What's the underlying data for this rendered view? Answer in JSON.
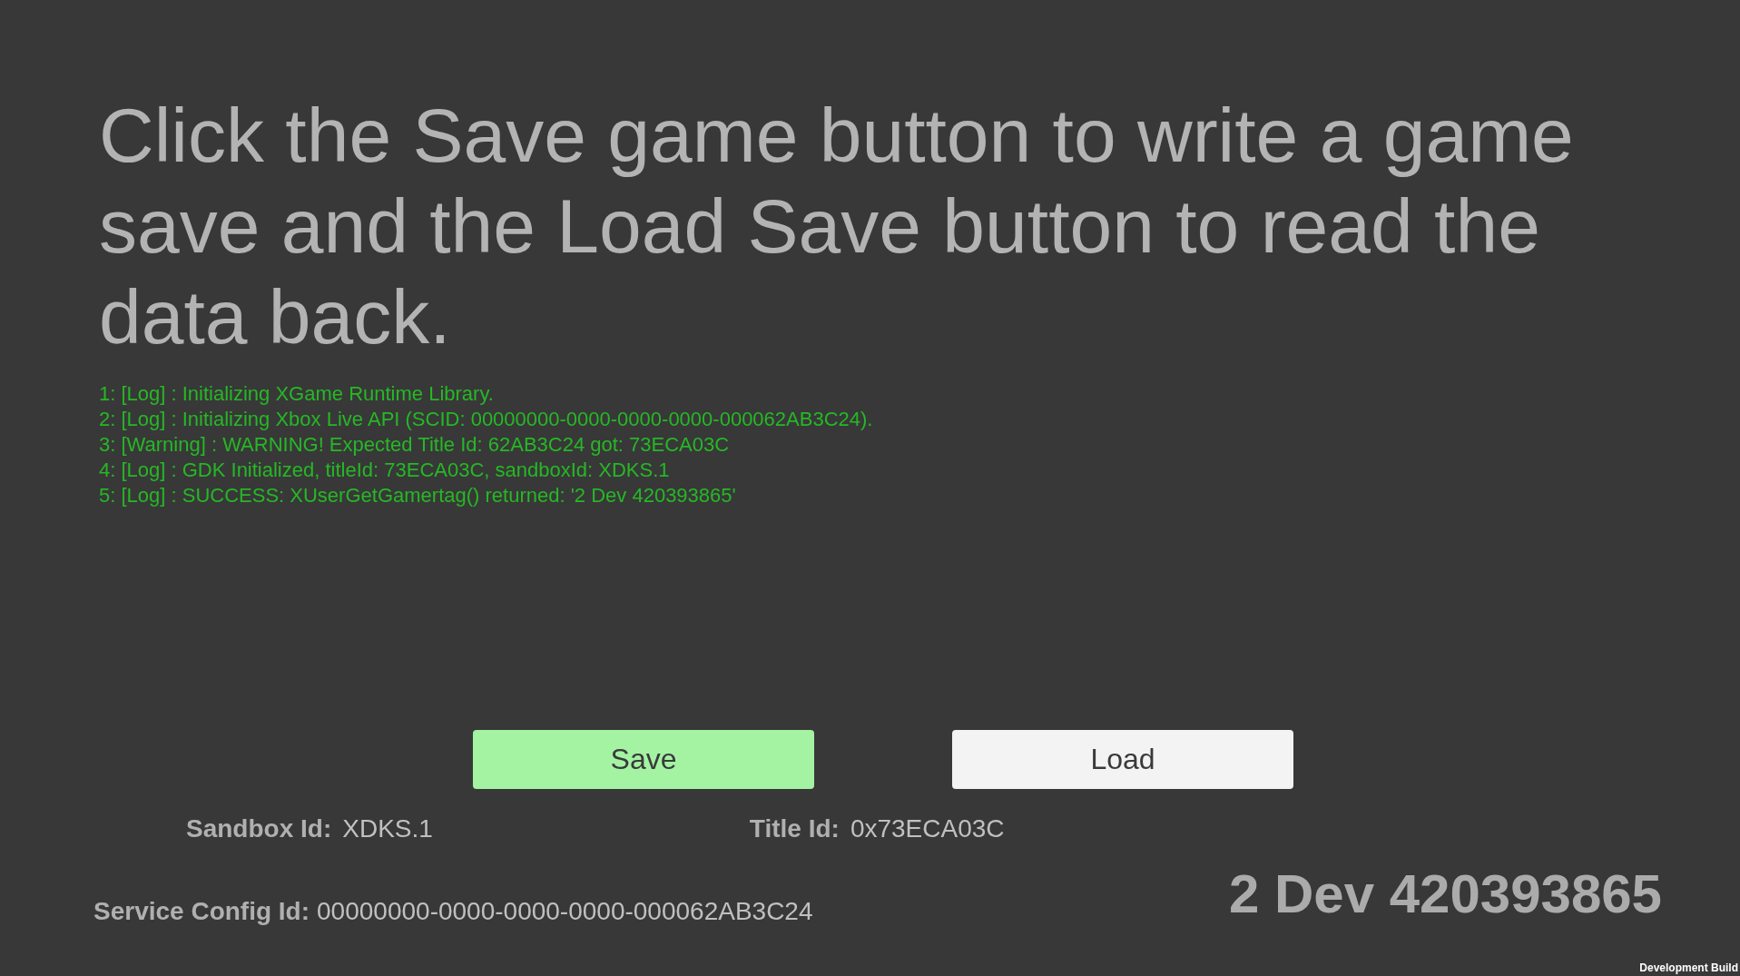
{
  "instruction": "Click the Save game button to write a game save and the Load Save button to read the data back.",
  "log": [
    "1: [Log] : Initializing XGame Runtime Library.",
    "2: [Log] : Initializing Xbox Live API (SCID: 00000000-0000-0000-0000-000062AB3C24).",
    "3: [Warning] : WARNING! Expected Title Id: 62AB3C24 got: 73ECA03C",
    "4: [Log] : GDK Initialized, titleId: 73ECA03C, sandboxId: XDKS.1",
    "5: [Log] : SUCCESS: XUserGetGamertag() returned: '2 Dev 420393865'"
  ],
  "buttons": [
    {
      "label": "Save",
      "kind": "primary"
    },
    {
      "label": "Load",
      "kind": "default"
    }
  ],
  "sandbox_id": {
    "label": "Sandbox Id:",
    "value": "XDKS.1"
  },
  "title_id": {
    "label": "Title Id:",
    "value": "0x73ECA03C"
  },
  "service_config_id": {
    "label": "Service Config Id:",
    "value": "00000000-0000-0000-0000-000062AB3C24"
  },
  "gamertag": "2 Dev 420393865",
  "build_label": "Development Build"
}
